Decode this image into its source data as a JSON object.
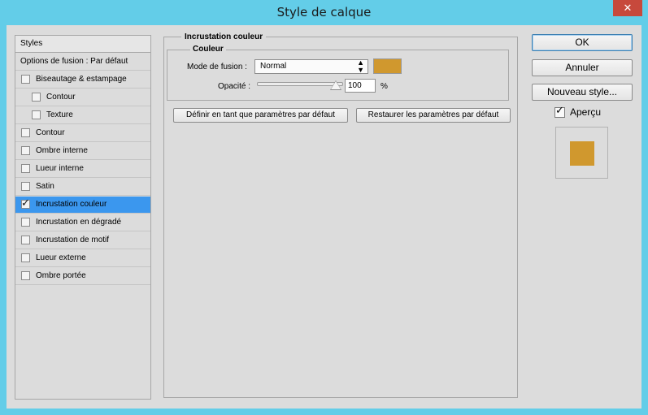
{
  "window": {
    "title": "Style de calque",
    "close_glyph": "✕"
  },
  "styles": {
    "header": "Styles",
    "options_label": "Options de fusion : Par défaut",
    "items": [
      {
        "label": "Biseautage & estampage",
        "checked": false,
        "indent": 0
      },
      {
        "label": "Contour",
        "checked": false,
        "indent": 1
      },
      {
        "label": "Texture",
        "checked": false,
        "indent": 1
      },
      {
        "label": "Contour",
        "checked": false,
        "indent": 0
      },
      {
        "label": "Ombre interne",
        "checked": false,
        "indent": 0
      },
      {
        "label": "Lueur interne",
        "checked": false,
        "indent": 0
      },
      {
        "label": "Satin",
        "checked": false,
        "indent": 0
      },
      {
        "label": "Incrustation couleur",
        "checked": true,
        "indent": 0,
        "selected": true
      },
      {
        "label": "Incrustation en dégradé",
        "checked": false,
        "indent": 0
      },
      {
        "label": "Incrustation de motif",
        "checked": false,
        "indent": 0
      },
      {
        "label": "Lueur externe",
        "checked": false,
        "indent": 0
      },
      {
        "label": "Ombre portée",
        "checked": false,
        "indent": 0
      }
    ]
  },
  "panel": {
    "title": "Incrustation couleur",
    "group_title": "Couleur",
    "blend_mode_label": "Mode de fusion :",
    "blend_mode_value": "Normal",
    "color": "#d0982e",
    "opacity_label": "Opacité :",
    "opacity_value": "100",
    "opacity_unit": "%",
    "opacity_fraction": 1.0,
    "set_default_label": "Définir en tant que paramètres par défaut",
    "restore_default_label": "Restaurer les paramètres par défaut"
  },
  "actions": {
    "ok_label": "OK",
    "cancel_label": "Annuler",
    "new_style_label": "Nouveau style...",
    "preview_label": "Aperçu",
    "preview_checked": true
  },
  "colors": {
    "title_bar": "#63cde8",
    "selection": "#3b97ee",
    "close_button": "#c7493c",
    "overlay": "#d0982e"
  }
}
